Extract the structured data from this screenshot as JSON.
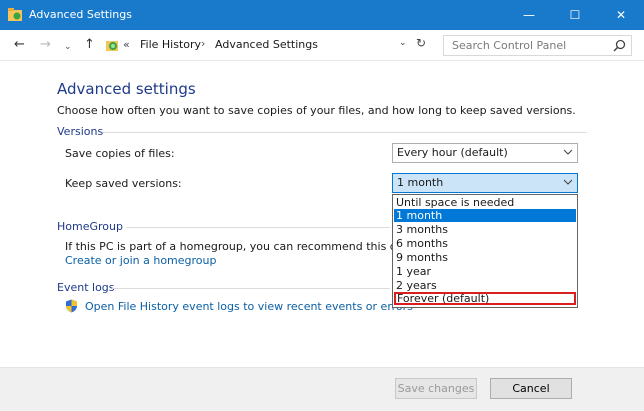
{
  "window": {
    "title": "Advanced Settings",
    "min_glyph": "—",
    "max_glyph": "☐",
    "close_glyph": "✕",
    "accent": "#1979ca"
  },
  "nav": {
    "back": "←",
    "forward": "→",
    "recent": "⌄",
    "up": "↑"
  },
  "address": {
    "prefix": "«",
    "crumbs": [
      "File History",
      "Advanced Settings"
    ],
    "separator": "›",
    "dropdown_glyph": "⌄",
    "refresh_glyph": "↻"
  },
  "search": {
    "placeholder": "Search Control Panel"
  },
  "main": {
    "heading": "Advanced settings",
    "description": "Choose how often you want to save copies of your files, and how long to keep saved versions."
  },
  "versions": {
    "group_label": "Versions",
    "save_copies_label": "Save copies of files:",
    "save_copies_value": "Every hour (default)",
    "keep_label": "Keep saved versions:",
    "keep_value": "1 month",
    "options": [
      "Until space is needed",
      "1 month",
      "3 months",
      "6 months",
      "9 months",
      "1 year",
      "2 years",
      "Forever (default)"
    ],
    "selected_option": "1 month",
    "highlighted_option": "Forever (default)"
  },
  "homegroup": {
    "group_label": "HomeGroup",
    "text": "If this PC is part of a homegroup, you can recommend this drive to",
    "link": "Create or join a homegroup"
  },
  "event_logs": {
    "group_label": "Event logs",
    "link": "Open File History event logs to view recent events or errors"
  },
  "footer": {
    "save_label": "Save changes",
    "cancel_label": "Cancel"
  }
}
